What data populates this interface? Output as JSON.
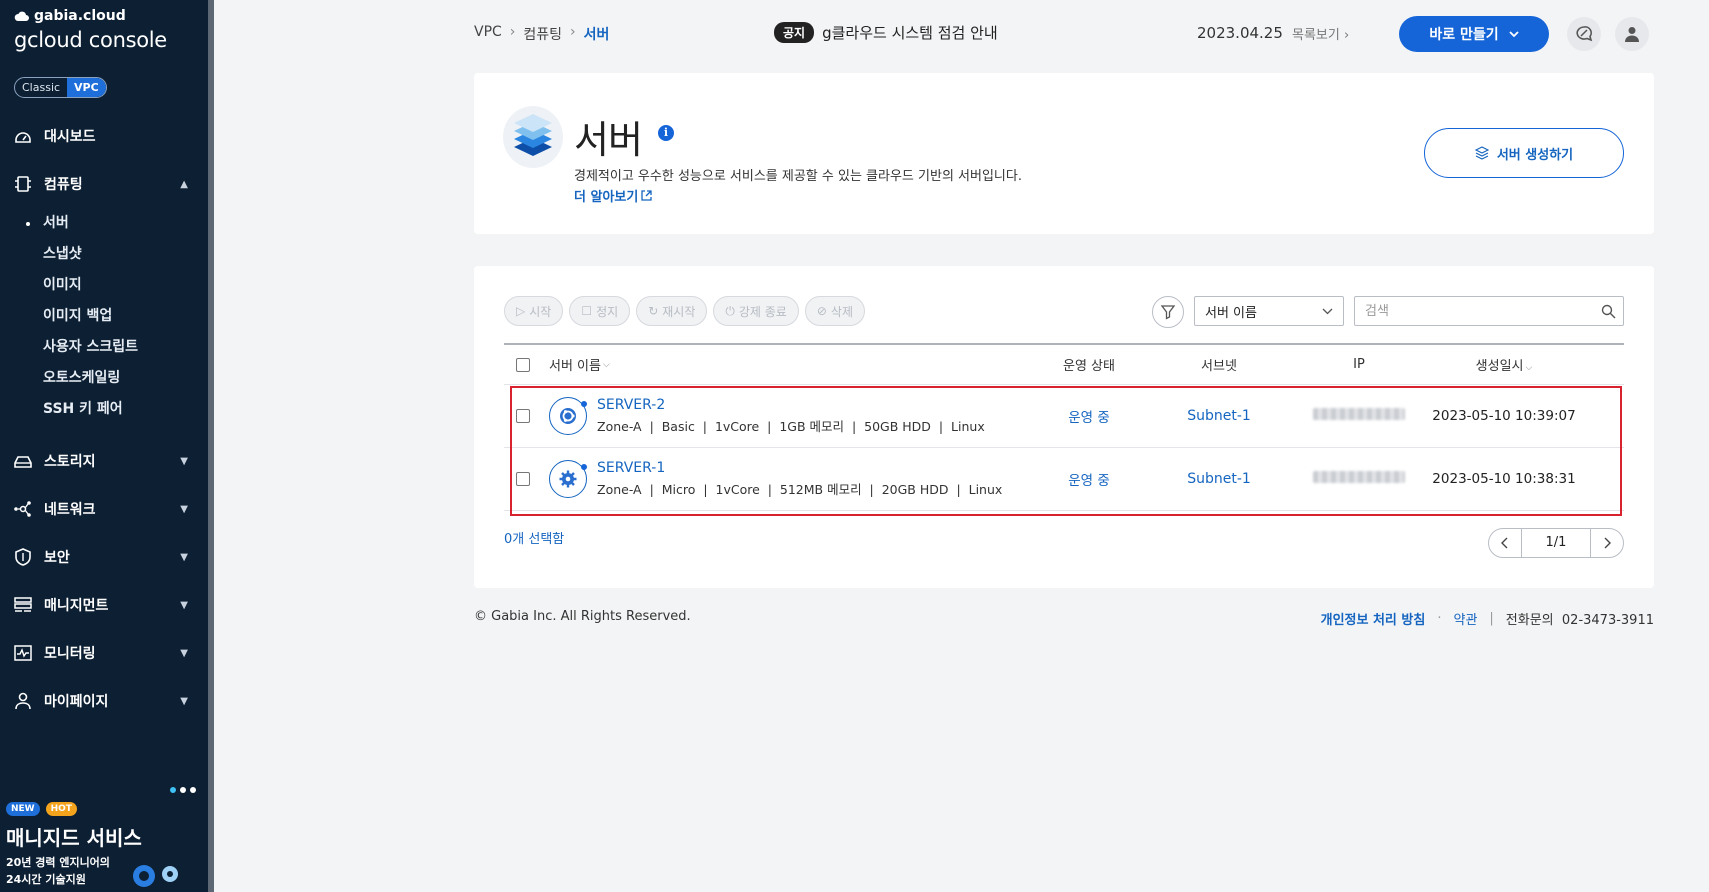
{
  "sidebar": {
    "brand_small": "gabia.cloud",
    "brand_big": "gcloud console",
    "env": {
      "classic": "Classic",
      "vpc": "VPC"
    },
    "items": [
      {
        "label": "대시보드",
        "icon": "dashboard-icon"
      },
      {
        "label": "컴퓨팅",
        "icon": "chip-icon",
        "expanded": true
      },
      {
        "label": "스토리지",
        "icon": "storage-icon"
      },
      {
        "label": "네트워크",
        "icon": "network-icon"
      },
      {
        "label": "보안",
        "icon": "shield-icon"
      },
      {
        "label": "매니지먼트",
        "icon": "management-icon"
      },
      {
        "label": "모니터링",
        "icon": "monitoring-icon"
      },
      {
        "label": "마이페이지",
        "icon": "user-icon"
      }
    ],
    "compute_sub": [
      "서버",
      "스냅샷",
      "이미지",
      "이미지 백업",
      "사용자 스크립트",
      "오토스케일링",
      "SSH 키 페어"
    ],
    "promo": {
      "badge_new": "NEW",
      "badge_hot": "HOT",
      "title": "매니지드 서비스",
      "sub1": "20년 경력 엔지니어의",
      "sub2": "24시간 기술지원"
    }
  },
  "topbar": {
    "breadcrumb": [
      "VPC",
      "컴퓨팅",
      "서버"
    ],
    "notice_tag": "공지",
    "notice_text": "g클라우드 시스템 점검 안내",
    "notice_date": "2023.04.25",
    "notice_more": "목록보기",
    "create_label": "바로 만들기"
  },
  "header": {
    "title": "서버",
    "info": "i",
    "description": "경제적이고 우수한 성능으로 서비스를 제공할 수 있는 클라우드 기반의 서버입니다.",
    "learn_more": "더 알아보기",
    "create_server": "서버 생성하기"
  },
  "toolbar": {
    "start": "시작",
    "stop": "정지",
    "restart": "재시작",
    "force_stop": "강제 종료",
    "delete": "삭제",
    "filter_select": "서버 이름",
    "search_placeholder": "검색"
  },
  "table": {
    "columns": {
      "name": "서버 이름",
      "status": "운영 상태",
      "subnet": "서브넷",
      "ip": "IP",
      "created": "생성일시"
    },
    "rows": [
      {
        "name": "SERVER-2",
        "zone": "Zone-A",
        "plan": "Basic",
        "cpu": "1vCore",
        "memory": "1GB 메모리",
        "disk": "50GB HDD",
        "os": "Linux",
        "status": "운영 중",
        "subnet": "Subnet-1",
        "created": "2023-05-10 10:39:07"
      },
      {
        "name": "SERVER-1",
        "zone": "Zone-A",
        "plan": "Micro",
        "cpu": "1vCore",
        "memory": "512MB 메모리",
        "disk": "20GB HDD",
        "os": "Linux",
        "status": "운영 중",
        "subnet": "Subnet-1",
        "created": "2023-05-10 10:38:31"
      }
    ],
    "selected_count": "0개 선택함",
    "page": "1/1"
  },
  "footer": {
    "copyright": "© Gabia Inc. All Rights Reserved.",
    "privacy": "개인정보 처리 방침",
    "dot": "·",
    "terms": "약관",
    "bar": "|",
    "phone_label": "전화문의",
    "phone": "02-3473-3911"
  },
  "colors": {
    "sidebar_bg": "#0c1f33",
    "accent": "#1565d8",
    "highlight": "#d8222f"
  }
}
